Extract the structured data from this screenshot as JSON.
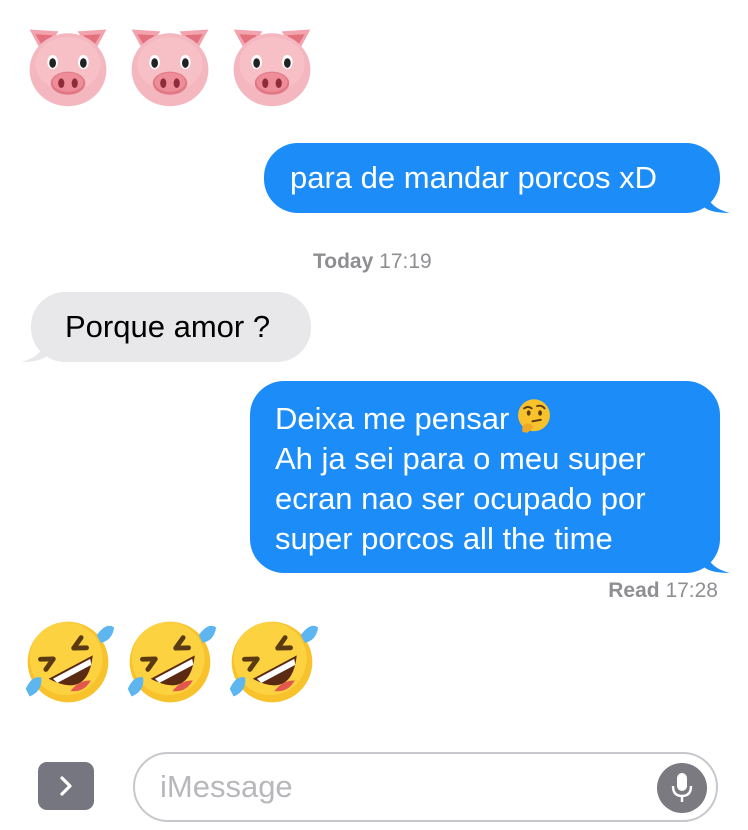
{
  "messages": {
    "pig_emojis": [
      "pig-face-emoji",
      "pig-face-emoji",
      "pig-face-emoji"
    ],
    "sent_1": "para de mandar porcos xD",
    "timestamp_1": {
      "day": "Today",
      "time": "17:19"
    },
    "received_1": "Porque amor ?",
    "sent_2_lines": [
      "Deixa me pensar",
      "Ah ja sei para o meu super",
      "ecran nao ser ocupado por",
      "super porcos all the time"
    ],
    "sent_2_emoji": "thinking-face-emoji",
    "read_receipt": {
      "label": "Read",
      "time": "17:28"
    },
    "laugh_emojis": [
      "rolling-on-the-floor-laughing-emoji",
      "rolling-on-the-floor-laughing-emoji",
      "rolling-on-the-floor-laughing-emoji"
    ]
  },
  "composer": {
    "placeholder": "iMessage",
    "apps_icon": "chevron-right-icon",
    "mic_icon": "microphone-icon"
  },
  "colors": {
    "sent_bubble": "#1b8cf8",
    "received_bubble": "#e8e8ea",
    "timestamp_text": "#8e8e93"
  }
}
